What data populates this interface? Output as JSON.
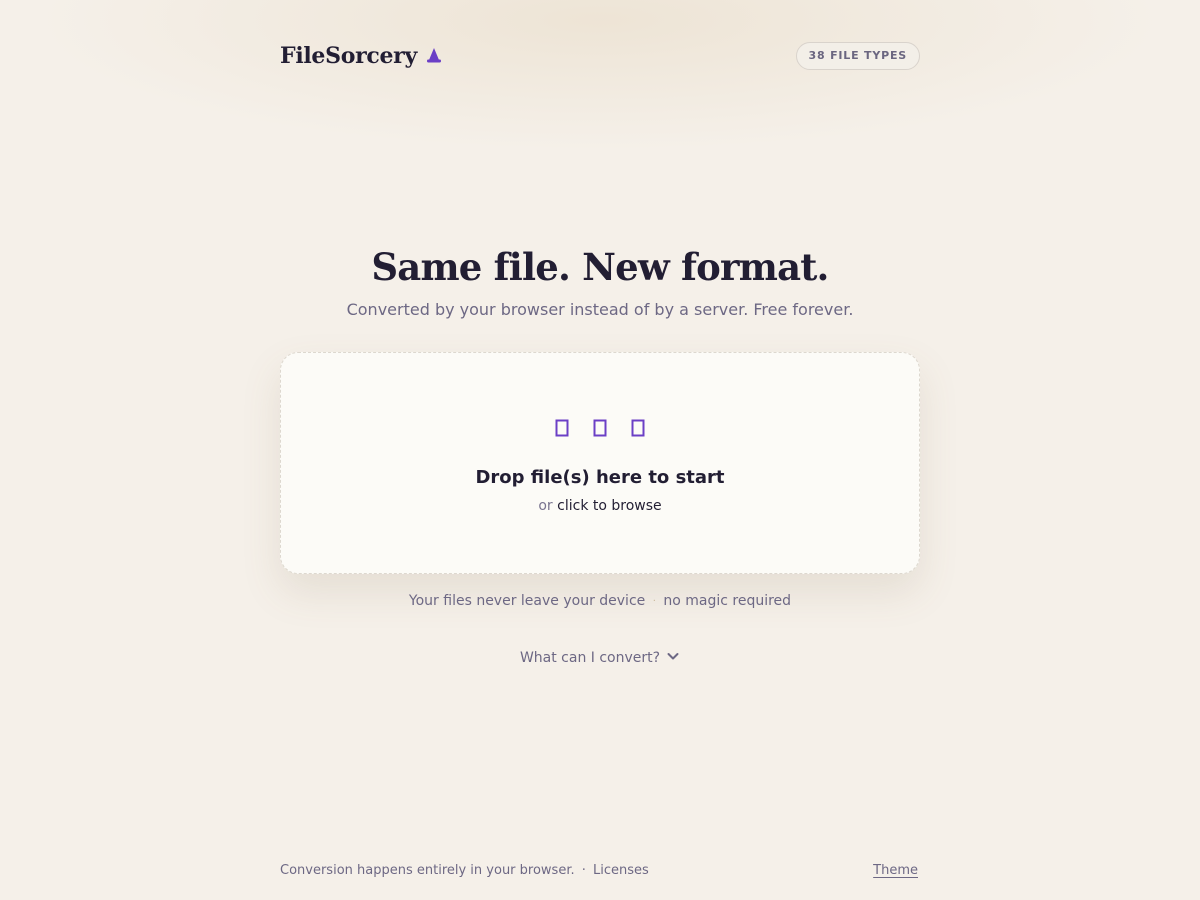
{
  "header": {
    "brand": "FileSorcery",
    "brand_icon": "wizard-hat-icon",
    "badge": "38 FILE TYPES"
  },
  "hero": {
    "title": "Same file. New format.",
    "subtitle": "Converted by your browser instead of by a server. Free forever."
  },
  "dropzone": {
    "icons": [
      "file-icon",
      "file-icon",
      "file-icon"
    ],
    "title": "Drop file(s) here to start",
    "prefix": "or",
    "browse_label": "click to browse"
  },
  "privacy": {
    "part1": "Your files never leave your device",
    "separator": "·",
    "part2": "no magic required"
  },
  "faq": {
    "label": "What can I convert?",
    "icon": "chevron-down-icon"
  },
  "footer": {
    "note": "Conversion happens entirely in your browser.",
    "separator": "·",
    "licenses": "Licenses",
    "theme": "Theme"
  },
  "colors": {
    "accent": "#6b3fc6",
    "background": "#f5f0e9",
    "text": "#221e33",
    "muted": "#6d6884"
  }
}
